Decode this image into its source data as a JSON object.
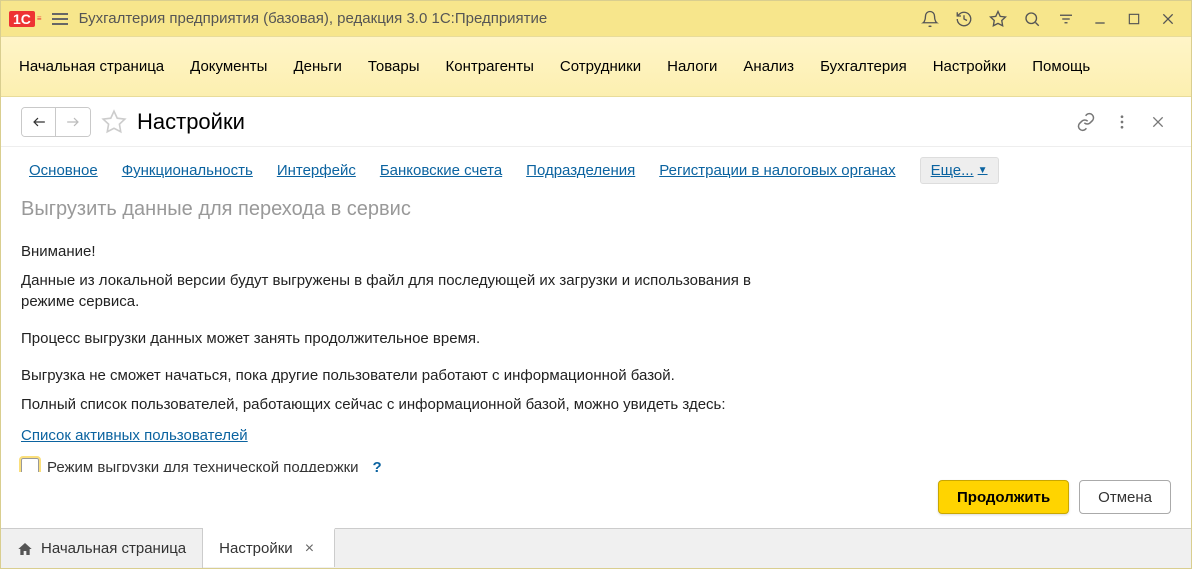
{
  "title_bar": {
    "app_title": "Бухгалтерия предприятия (базовая), редакция 3.0 1С:Предприятие"
  },
  "main_menu": {
    "items": [
      "Начальная страница",
      "Документы",
      "Деньги",
      "Товары",
      "Контрагенты",
      "Сотрудники",
      "Налоги",
      "Анализ",
      "Бухгалтерия",
      "Настройки",
      "Помощь"
    ]
  },
  "page": {
    "title": "Настройки",
    "sub_nav": {
      "links": [
        "Основное",
        "Функциональность",
        "Интерфейс",
        "Банковские счета",
        "Подразделения",
        "Регистрации в налоговых органах"
      ],
      "more_label": "Еще..."
    },
    "section_heading": "Выгрузить данные для перехода в сервис",
    "para1": "Внимание!",
    "para2": "Данные из локальной версии будут выгружены в файл для последующей их загрузки и использования в режиме сервиса.",
    "para3": "Процесс выгрузки данных может занять продолжительное время.",
    "para4": "Выгрузка не сможет начаться, пока другие пользователи работают с информационной базой.",
    "para5": "Полный список пользователей, работающих сейчас с информационной базой, можно увидеть здесь:",
    "active_users_link": "Список активных пользователей",
    "checkbox_label": "Режим выгрузки для технической поддержки",
    "help_icon": "?",
    "buttons": {
      "continue": "Продолжить",
      "cancel": "Отмена"
    }
  },
  "bottom_tabs": {
    "items": [
      {
        "label": "Начальная страница",
        "closable": false,
        "icon": "home"
      },
      {
        "label": "Настройки",
        "closable": true
      }
    ]
  }
}
